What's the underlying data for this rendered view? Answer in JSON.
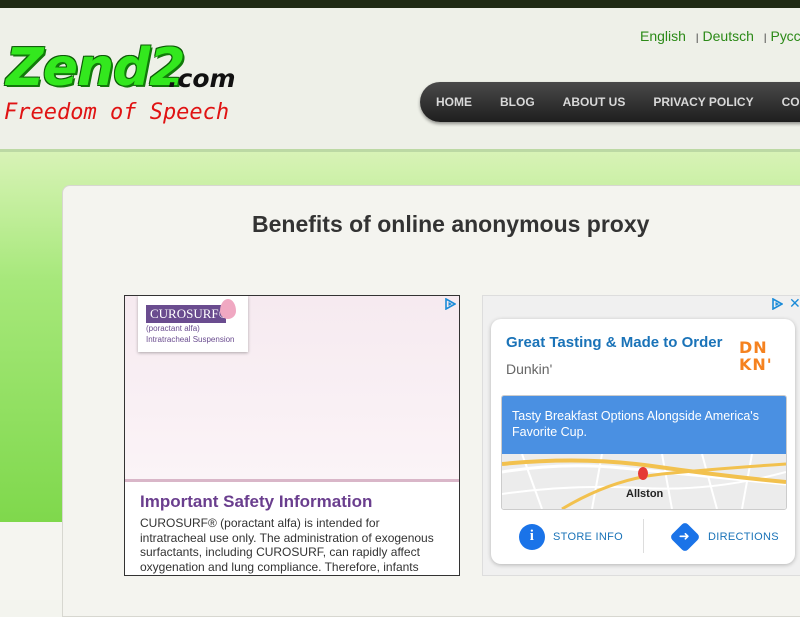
{
  "logo": {
    "main": "Zend2",
    "domain": ".com",
    "tagline": "Freedom of Speech"
  },
  "languages": [
    {
      "label": "English"
    },
    {
      "label": "Deutsch"
    },
    {
      "label": "Русс"
    }
  ],
  "language_separator": "|",
  "nav": {
    "items": [
      {
        "label": "HOME"
      },
      {
        "label": "BLOG"
      },
      {
        "label": "ABOUT US"
      },
      {
        "label": "PRIVACY POLICY"
      },
      {
        "label": "CO"
      }
    ]
  },
  "page": {
    "title": "Benefits of online anonymous proxy"
  },
  "ad1": {
    "brand": "CUROSURF®",
    "brand_sub1": "(poractant alfa)",
    "brand_sub2": "Intratracheal Suspension",
    "heading": "Important Safety Information",
    "body": "CUROSURF® (poractant alfa) is intended for intratracheal use only. The administration of exogenous surfactants, including CUROSURF, can rapidly affect oxygenation and lung compliance. Therefore, infants"
  },
  "ad2": {
    "title": "Great Tasting & Made to Order",
    "advertiser": "Dunkin'",
    "logo_top": "DN",
    "logo_bottom": "KN'",
    "promo": "Tasty Breakfast Options Alongside America's Favorite Cup.",
    "map_label": "Allston",
    "store_info": "STORE INFO",
    "directions": "DIRECTIONS"
  },
  "colors": {
    "accent_green": "#33e81e",
    "link_green": "#2c8a18",
    "nav_dark": "#1e1e1e",
    "ad_blue": "#1a73b8",
    "dunkin_orange": "#f5821f",
    "dunkin_pink": "#e0167e"
  },
  "icons": [
    "adchoices-icon",
    "close-icon",
    "info-icon",
    "directions-icon",
    "map-pin-icon"
  ]
}
